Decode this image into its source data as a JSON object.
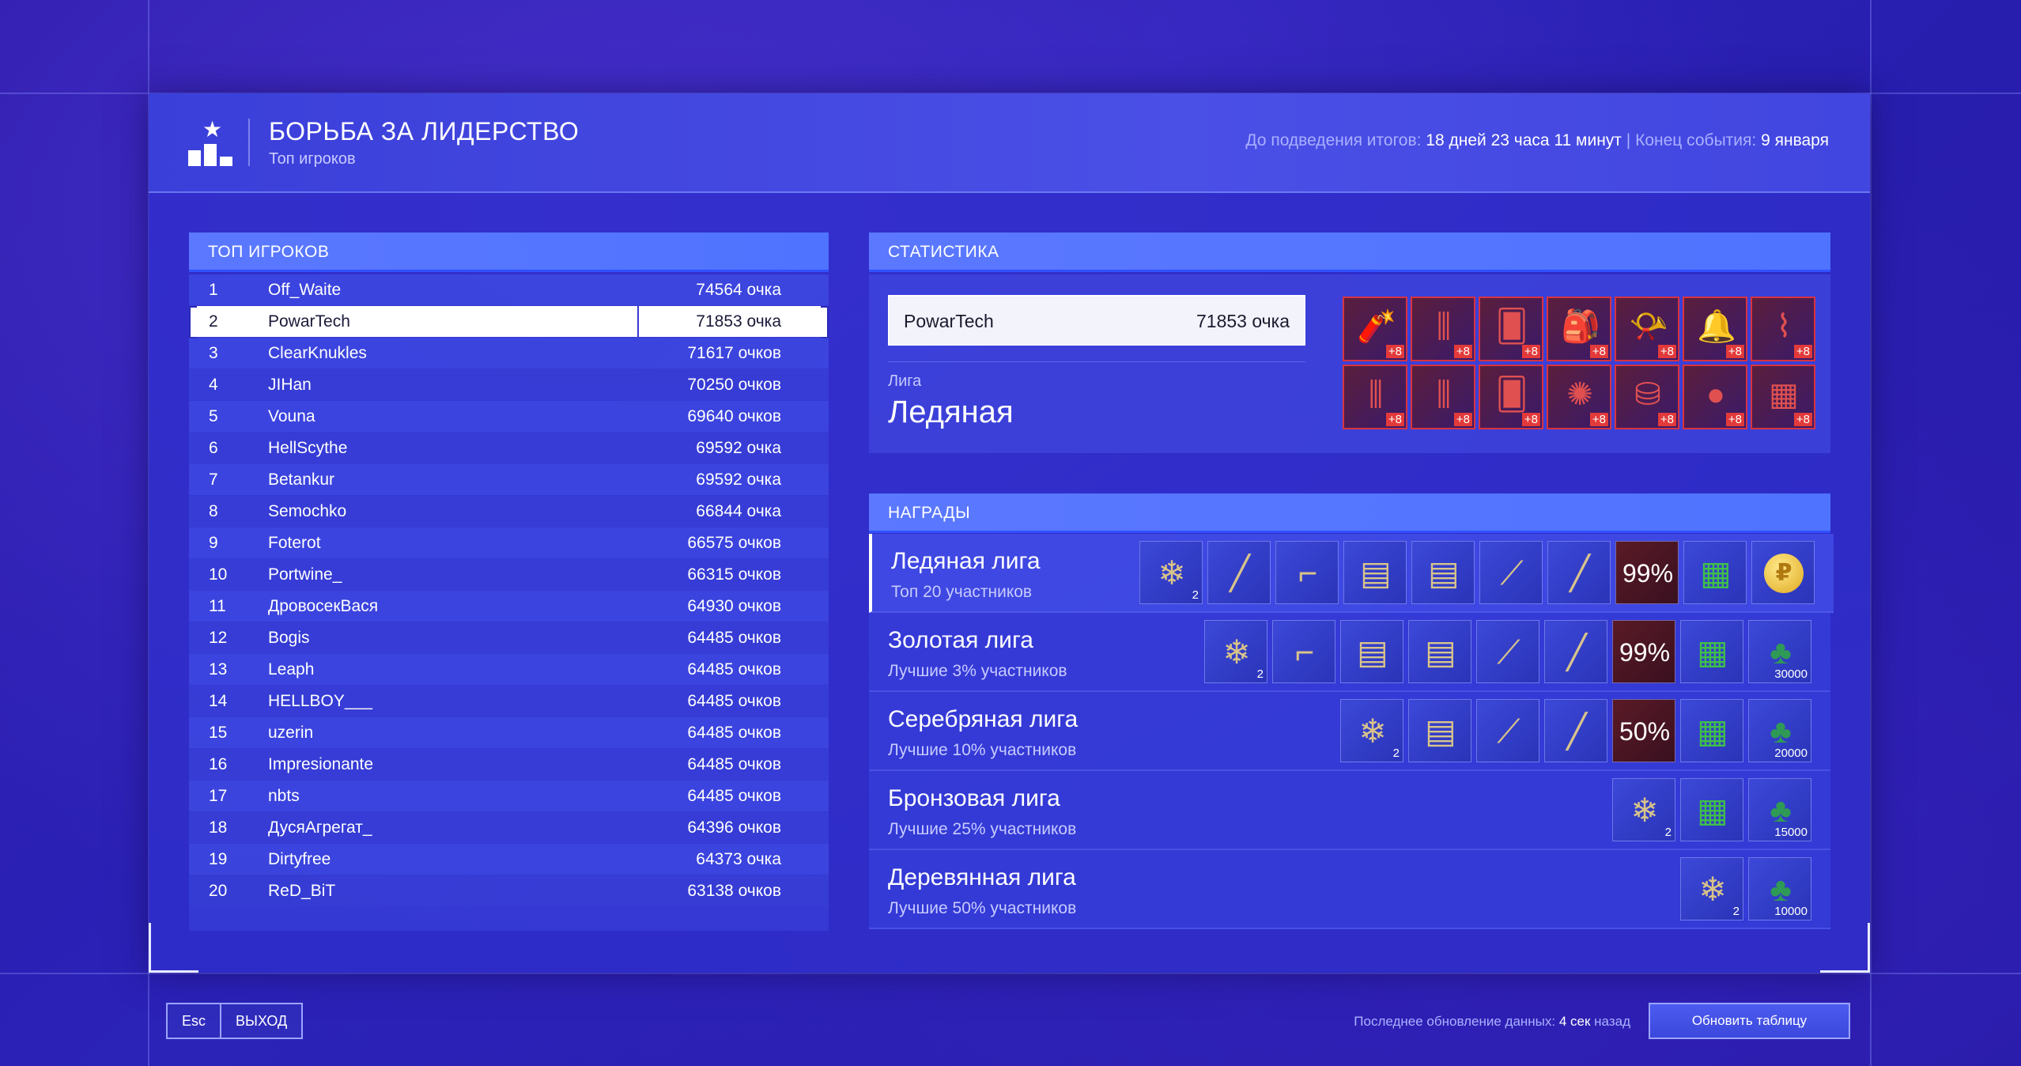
{
  "header": {
    "title": "БОРЬБА ЗА ЛИДЕРСТВО",
    "subtitle": "Топ игроков",
    "until_label": "До подведения итогов:",
    "until_value": "18 дней 23 часа 11 минут",
    "separator": "|",
    "end_label": "Конец события:",
    "end_value": "9 января"
  },
  "top_players": {
    "title": "ТОП ИГРОКОВ",
    "rows": [
      {
        "rank": "1",
        "name": "Off_Waite",
        "score": "74564 очка"
      },
      {
        "rank": "2",
        "name": "PowarTech",
        "score": "71853 очка"
      },
      {
        "rank": "3",
        "name": "ClearKnukles",
        "score": "71617 очков"
      },
      {
        "rank": "4",
        "name": "JIHan",
        "score": "70250 очков"
      },
      {
        "rank": "5",
        "name": "Vouna",
        "score": "69640 очков"
      },
      {
        "rank": "6",
        "name": "HellScythe",
        "score": "69592 очка"
      },
      {
        "rank": "7",
        "name": "Betankur",
        "score": "69592 очка"
      },
      {
        "rank": "8",
        "name": "Semochko",
        "score": "66844 очка"
      },
      {
        "rank": "9",
        "name": "Foterot",
        "score": "66575 очков"
      },
      {
        "rank": "10",
        "name": "Portwine_",
        "score": "66315 очков"
      },
      {
        "rank": "11",
        "name": "ДровосекВася",
        "score": "64930 очков"
      },
      {
        "rank": "12",
        "name": "Bogis",
        "score": "64485 очков"
      },
      {
        "rank": "13",
        "name": "Leaph",
        "score": "64485 очков"
      },
      {
        "rank": "14",
        "name": "HELLBOY___",
        "score": "64485 очков"
      },
      {
        "rank": "15",
        "name": "uzerin",
        "score": "64485 очков"
      },
      {
        "rank": "16",
        "name": "Impresionante",
        "score": "64485 очков"
      },
      {
        "rank": "17",
        "name": "nbts",
        "score": "64485 очков"
      },
      {
        "rank": "18",
        "name": "ДусяАгрегат_",
        "score": "64396 очков"
      },
      {
        "rank": "19",
        "name": "Dirtyfree",
        "score": "64373 очка"
      },
      {
        "rank": "20",
        "name": "ReD_BiT",
        "score": "63138 очков"
      }
    ]
  },
  "stats": {
    "title": "СТАТИСТИКА",
    "player_name": "PowarTech",
    "player_score": "71853 очка",
    "league_label": "Лига",
    "league_value": "Ледяная",
    "item_badge": "+8",
    "items": [
      "dynamite-icon",
      "bars-icon",
      "cards-icon",
      "backpack-icon",
      "horn-icon",
      "bells-icon",
      "candy-cane-icon",
      "bars-icon",
      "bars-icon",
      "cards-icon",
      "ornament-icon",
      "bag-icon",
      "grenade-icon",
      "gift-icon"
    ]
  },
  "rewards": {
    "title": "НАГРАДЫ",
    "leagues": [
      {
        "name": "Ледяная лига",
        "desc": "Топ 20 участников",
        "items": [
          {
            "icon": "snowflake-icon",
            "count": "2"
          },
          {
            "icon": "rifle-icon",
            "count": ""
          },
          {
            "icon": "pistol-icon",
            "count": ""
          },
          {
            "icon": "ammo-icon",
            "count": ""
          },
          {
            "icon": "ammo-icon",
            "count": ""
          },
          {
            "icon": "sniper-icon",
            "count": ""
          },
          {
            "icon": "rifle-icon",
            "count": ""
          },
          {
            "icon": "percent",
            "label": "99%"
          },
          {
            "icon": "gift-icon",
            "count": ""
          },
          {
            "icon": "coin-icon",
            "label": "₽"
          }
        ]
      },
      {
        "name": "Золотая лига",
        "desc": "Лучшие 3% участников",
        "items": [
          {
            "icon": "snowflake-icon",
            "count": "2"
          },
          {
            "icon": "pistol-icon",
            "count": ""
          },
          {
            "icon": "ammo-icon",
            "count": ""
          },
          {
            "icon": "ammo-icon",
            "count": ""
          },
          {
            "icon": "sniper-icon",
            "count": ""
          },
          {
            "icon": "rifle-icon",
            "count": ""
          },
          {
            "icon": "percent",
            "label": "99%"
          },
          {
            "icon": "gift-icon",
            "count": ""
          },
          {
            "icon": "cone-icon",
            "count": "30000"
          }
        ]
      },
      {
        "name": "Серебряная лига",
        "desc": "Лучшие 10% участников",
        "items": [
          {
            "icon": "snowflake-icon",
            "count": "2"
          },
          {
            "icon": "ammo-icon",
            "count": ""
          },
          {
            "icon": "sniper-icon",
            "count": ""
          },
          {
            "icon": "rifle-icon",
            "count": ""
          },
          {
            "icon": "percent",
            "label": "50%"
          },
          {
            "icon": "gift-icon",
            "count": ""
          },
          {
            "icon": "cone-icon",
            "count": "20000"
          }
        ]
      },
      {
        "name": "Бронзовая лига",
        "desc": "Лучшие 25% участников",
        "items": [
          {
            "icon": "snowflake-icon",
            "count": "2"
          },
          {
            "icon": "gift-icon",
            "count": ""
          },
          {
            "icon": "cone-icon",
            "count": "15000"
          }
        ]
      },
      {
        "name": "Деревянная лига",
        "desc": "Лучшие 50% участников",
        "items": [
          {
            "icon": "snowflake-icon",
            "count": "2"
          },
          {
            "icon": "cone-icon",
            "count": "10000"
          }
        ]
      }
    ]
  },
  "footer": {
    "esc_key": "Esc",
    "exit_label": "ВЫХОД",
    "updated_label": "Последнее обновление данных:",
    "updated_value": "4 сек",
    "updated_suffix": "назад",
    "refresh_label": "Обновить таблицу"
  }
}
